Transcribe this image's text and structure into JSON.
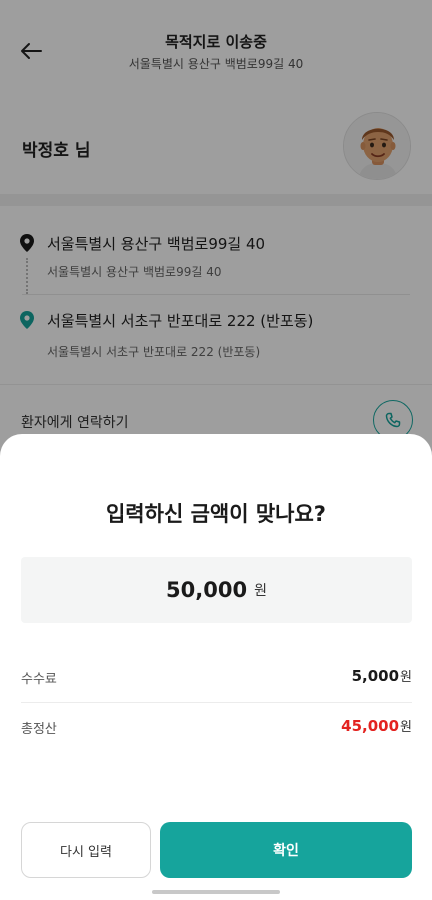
{
  "header": {
    "title": "목적지로 이송중",
    "subtitle": "서울특별시 용산구 백범로99길 40",
    "back_icon": "arrow-left-icon"
  },
  "user": {
    "name": "박정호 님",
    "avatar_icon": "avatar-icon"
  },
  "route": {
    "origin": {
      "address": "서울특별시 용산구 백범로99길 40",
      "detail": "서울특별시 용산구 백범로99길 40",
      "icon": "map-pin-black-icon"
    },
    "destination": {
      "address": "서울특별시 서초구 반포대로 222 (반포동)",
      "detail": "서울특별시 서초구 반포대로 222 (반포동)",
      "icon": "map-pin-teal-icon"
    }
  },
  "contact": {
    "label": "환자에게 연락하기",
    "icon": "phone-icon"
  },
  "sheet": {
    "title": "입력하신 금액이 맞나요?",
    "amount": "50,000",
    "amount_unit": "원",
    "fee_label": "수수료",
    "fee_value": "5,000",
    "fee_unit": "원",
    "total_label": "총정산",
    "total_value": "45,000",
    "total_unit": "원",
    "retry_label": "다시 입력",
    "confirm_label": "확인"
  },
  "colors": {
    "accent": "#16a49c",
    "total_red": "#e3221f",
    "dim_overlay": "rgba(0,0,0,0.38)"
  }
}
